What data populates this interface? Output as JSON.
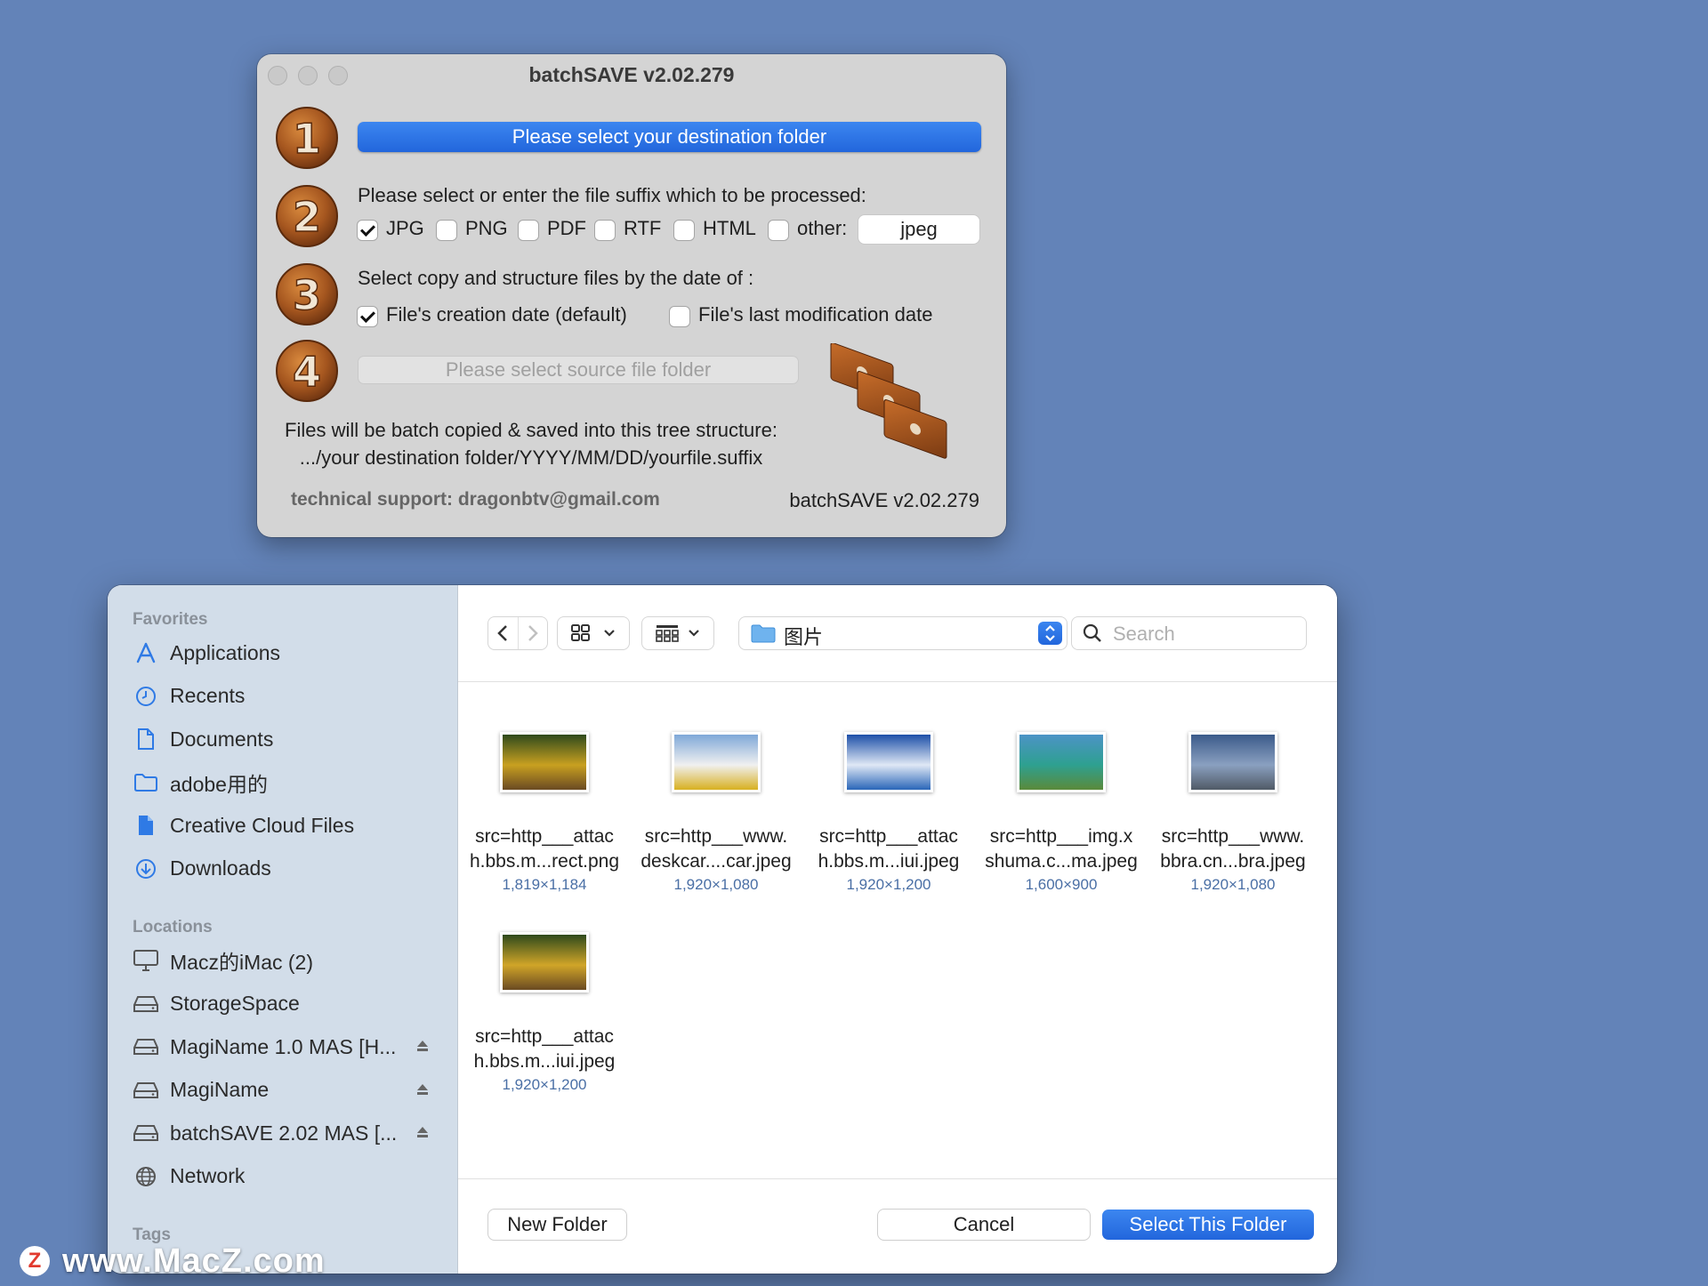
{
  "batchsave": {
    "title": "batchSAVE  v2.02.279",
    "step1": {
      "badge": "1",
      "button": "Please select your destination folder"
    },
    "step2": {
      "badge": "2",
      "prompt": "Please select or enter the file suffix which to be processed:",
      "options": [
        {
          "label": "JPG",
          "checked": true
        },
        {
          "label": "PNG",
          "checked": false
        },
        {
          "label": "PDF",
          "checked": false
        },
        {
          "label": "RTF",
          "checked": false
        },
        {
          "label": "HTML",
          "checked": false
        },
        {
          "label": "other:",
          "checked": false
        }
      ],
      "other_value": "jpeg"
    },
    "step3": {
      "badge": "3",
      "prompt": "Select copy and structure files by the date of :",
      "options": [
        {
          "label": "File's creation date (default)",
          "checked": true
        },
        {
          "label": "File's last modification date",
          "checked": false
        }
      ]
    },
    "step4": {
      "badge": "4",
      "button": "Please select source file folder"
    },
    "tree_line1": "Files will be batch copied & saved into this tree structure:",
    "tree_line2": ".../your destination folder/YYYY/MM/DD/yourfile.suffix",
    "support": "technical support:  dragonbtv@gmail.com",
    "version": "batchSAVE  v2.02.279"
  },
  "dialog": {
    "sidebar": {
      "favorites_title": "Favorites",
      "favorites": [
        {
          "label": "Applications",
          "icon": "applications-icon"
        },
        {
          "label": "Recents",
          "icon": "clock-icon"
        },
        {
          "label": "Documents",
          "icon": "document-icon"
        },
        {
          "label": "adobe用的",
          "icon": "folder-icon"
        },
        {
          "label": "Creative Cloud Files",
          "icon": "file-icon"
        },
        {
          "label": "Downloads",
          "icon": "download-icon"
        }
      ],
      "locations_title": "Locations",
      "locations": [
        {
          "label": "Macz的iMac (2)",
          "icon": "imac-icon",
          "eject": false
        },
        {
          "label": "StorageSpace",
          "icon": "drive-icon",
          "eject": false
        },
        {
          "label": "MagiName 1.0 MAS [H...",
          "icon": "drive-icon",
          "eject": true
        },
        {
          "label": "MagiName",
          "icon": "drive-icon",
          "eject": true
        },
        {
          "label": "batchSAVE 2.02 MAS [...",
          "icon": "drive-icon",
          "eject": true
        },
        {
          "label": "Network",
          "icon": "globe-icon",
          "eject": false
        }
      ],
      "tags_title": "Tags"
    },
    "toolbar": {
      "path_label": "图片",
      "search_placeholder": "Search"
    },
    "files": [
      {
        "line1": "src=http___attac",
        "line2": "h.bbs.m...rect.png",
        "dims": "1,819×1,184",
        "palette": [
          "#2e4a1c",
          "#c8a020",
          "#6a4a22"
        ]
      },
      {
        "line1": "src=http___www.",
        "line2": "deskcar....car.jpeg",
        "dims": "1,920×1,080",
        "palette": [
          "#7fa8d8",
          "#f0f0f0",
          "#d8b020"
        ]
      },
      {
        "line1": "src=http___attac",
        "line2": "h.bbs.m...iui.jpeg",
        "dims": "1,920×1,200",
        "palette": [
          "#1d4fa8",
          "#dfe8f5",
          "#2a66b8"
        ]
      },
      {
        "line1": "src=http___img.x",
        "line2": "shuma.c...ma.jpeg",
        "dims": "1,600×900",
        "palette": [
          "#4c93c6",
          "#2ea090",
          "#5a8a3a"
        ]
      },
      {
        "line1": "src=http___www.",
        "line2": "bbra.cn...bra.jpeg",
        "dims": "1,920×1,080",
        "palette": [
          "#3b5a8a",
          "#8aa0c0",
          "#505a66"
        ]
      },
      {
        "line1": "src=http___attac",
        "line2": "h.bbs.m...iui.jpeg",
        "dims": "1,920×1,200",
        "palette": [
          "#2e4a1c",
          "#d0a528",
          "#6a4a22"
        ]
      }
    ],
    "footer": {
      "new_folder": "New Folder",
      "cancel": "Cancel",
      "select": "Select This Folder"
    }
  },
  "watermark": {
    "logo": "Z",
    "text": "www.MacZ.com"
  }
}
